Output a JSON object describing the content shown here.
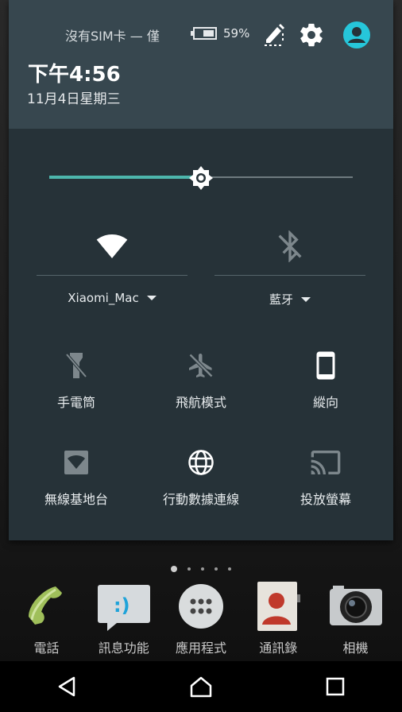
{
  "status_bar": {
    "carrier": "沒有SIM卡 — 僅",
    "battery_percent": "59%",
    "battery_level": 0.59
  },
  "header": {
    "time": "下午4:56",
    "date": "11月4日星期三"
  },
  "brightness": {
    "level": 0.5
  },
  "tiles_top": [
    {
      "label": "Xiaomi_Mac",
      "icon": "wifi-icon",
      "active": true
    },
    {
      "label": "藍牙",
      "icon": "bluetooth-off-icon",
      "active": false
    }
  ],
  "tiles": [
    {
      "label": "手電筒",
      "icon": "flashlight-off-icon",
      "active": false
    },
    {
      "label": "飛航模式",
      "icon": "airplane-off-icon",
      "active": false
    },
    {
      "label": "縱向",
      "icon": "portrait-icon",
      "active": true
    },
    {
      "label": "無線基地台",
      "icon": "hotspot-icon",
      "active": false
    },
    {
      "label": "行動數據連線",
      "icon": "globe-icon",
      "active": true
    },
    {
      "label": "投放螢幕",
      "icon": "cast-icon",
      "active": false
    }
  ],
  "dock": [
    {
      "label": "電話",
      "icon": "phone-icon"
    },
    {
      "label": "訊息功能",
      "icon": "messaging-icon"
    },
    {
      "label": "應用程式",
      "icon": "apps-icon"
    },
    {
      "label": "通訊錄",
      "icon": "contacts-icon"
    },
    {
      "label": "相機",
      "icon": "camera-icon"
    }
  ],
  "colors": {
    "accent": "#4db6ac",
    "shade": "#263238",
    "header": "#37474f",
    "account": "#26c6da"
  }
}
